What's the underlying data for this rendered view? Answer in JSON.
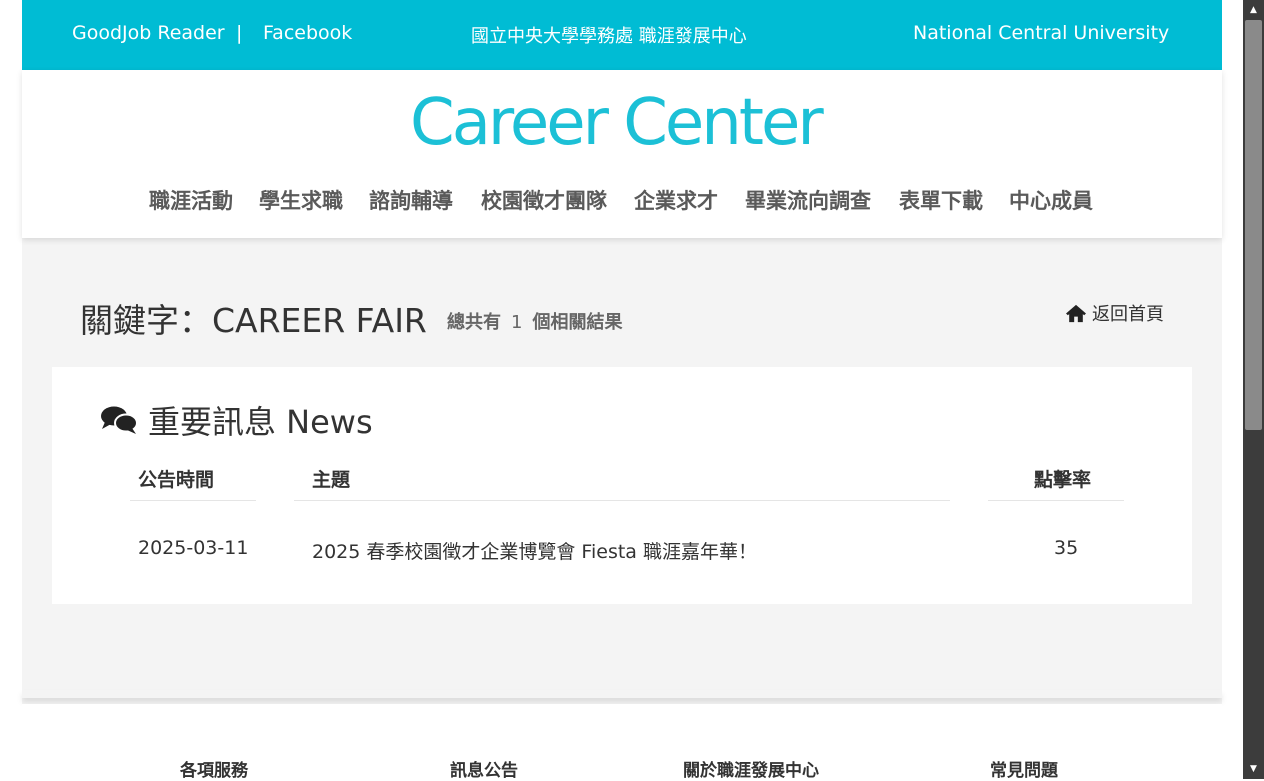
{
  "topbar": {
    "reader_label": "GoodJob Reader",
    "separator": "|",
    "facebook_label": "Facebook",
    "office_label": "國立中央大學學務處 職涯發展中心",
    "university_label": "National Central University"
  },
  "header": {
    "logo_text": "Career Center",
    "nav": [
      {
        "label": "職涯活動"
      },
      {
        "label": "學生求職"
      },
      {
        "label": "諮詢輔導"
      },
      {
        "label": "校園徵才團隊"
      },
      {
        "label": "企業求才"
      },
      {
        "label": "畢業流向調查"
      },
      {
        "label": "表單下載"
      },
      {
        "label": "中心成員"
      }
    ]
  },
  "search": {
    "title": "關鍵字：CAREER FAIR",
    "count_prefix": "總共有",
    "count": "1",
    "count_suffix": "個相關結果",
    "back_label": "返回首頁",
    "back_icon": "home-icon"
  },
  "news": {
    "title": "重要訊息 News",
    "icon": "comments-icon",
    "columns": {
      "date": "公告時間",
      "subject": "主題",
      "clicks": "點擊率"
    },
    "rows": [
      {
        "date": "2025-03-11",
        "subject": "2025 春季校園徵才企業博覽會 Fiesta 職涯嘉年華！",
        "clicks": "35"
      }
    ]
  },
  "footer": {
    "columns": [
      "各項服務",
      "訊息公告",
      "關於職涯發展中心",
      "常見問題"
    ]
  },
  "colors": {
    "topbar": "#00bcd4",
    "logo": "#1cc0d6",
    "background": "#f4f4f4"
  }
}
